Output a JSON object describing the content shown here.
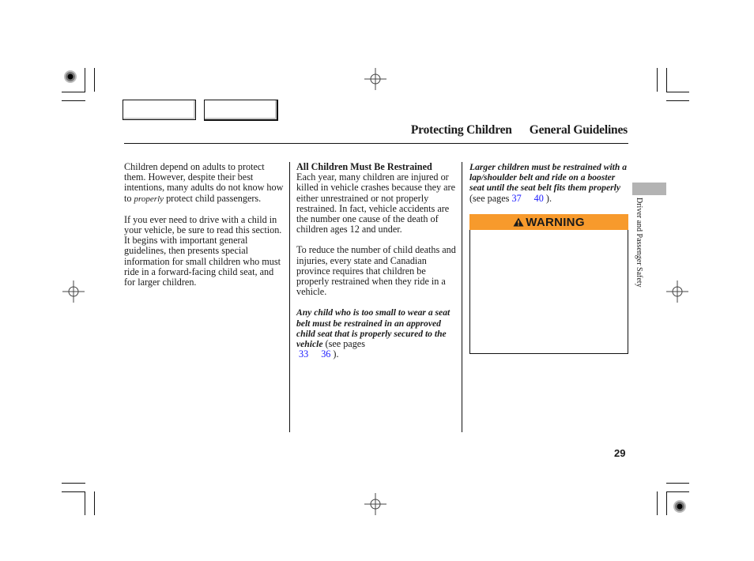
{
  "header": {
    "section_title": "Protecting Children",
    "subsection_title": "General Guidelines"
  },
  "nav": {
    "prev_label": "",
    "next_label": ""
  },
  "column1": {
    "para1_part1": "Children depend on adults to protect them. However, despite their best intentions, many adults do not know how to ",
    "para1_emphasis": "properly",
    "para1_part2": " protect child passengers.",
    "para2": "If you ever need to drive with a child in your vehicle, be sure to read this section. It begins with important general guidelines, then presents special information for small children who must ride in a forward-facing child seat, and for larger children."
  },
  "column2": {
    "heading": "All Children Must Be Restrained",
    "para1": "Each year, many children are injured or killed in vehicle crashes because they are either unrestrained or not properly restrained. In fact, vehicle accidents are the number one cause of the death of children ages 12 and under.",
    "para2": "To reduce the number of child deaths and injuries, every state and Canadian province requires that children be properly restrained when they ride in a vehicle.",
    "para3_emphasis": "Any child who is too small to wear a seat belt must be restrained in an approved child seat that is properly secured to the vehicle",
    "para3_see": " (see pages ",
    "para3_link1": "33",
    "para3_link2": "36",
    "para3_end": " )."
  },
  "column3": {
    "para1_emphasis": "Larger children must be restrained with a lap/shoulder belt and ride on a booster seat until the seat belt fits them properly",
    "para1_see": " (see pages ",
    "para1_link1": "37",
    "para1_link2": "40",
    "para1_end": " ).",
    "warning": {
      "icon": "warning-triangle-icon",
      "label": "WARNING",
      "color": "#f79a2c",
      "body": ""
    }
  },
  "sidebar": {
    "chapter_label": "Driver and Passenger Safety",
    "tab_color": "#b3b3b3"
  },
  "footer": {
    "page_number": "29"
  }
}
